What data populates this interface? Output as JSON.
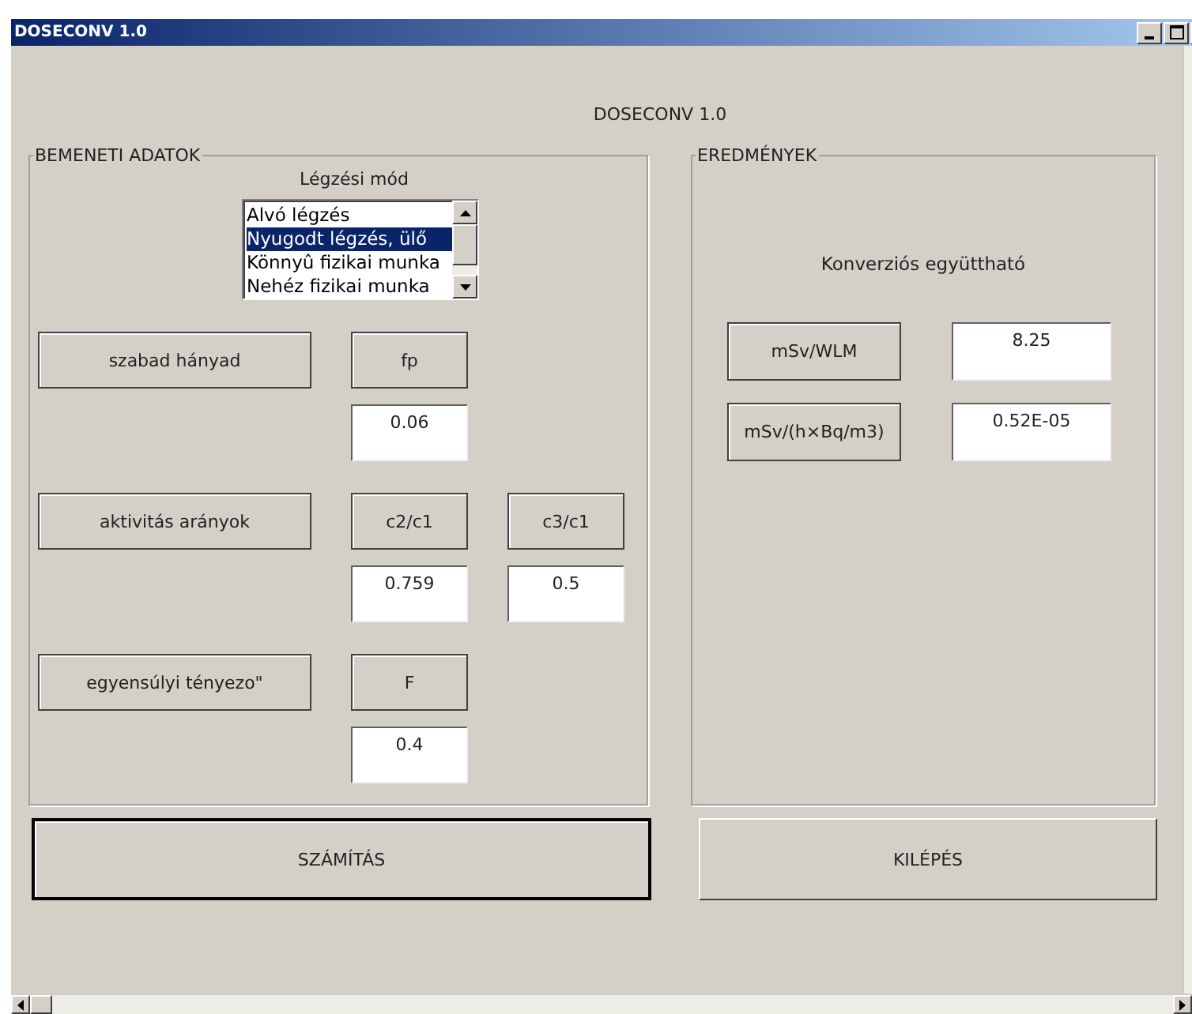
{
  "window": {
    "title": "DOSECONV 1.0"
  },
  "heading": "DOSECONV 1.0",
  "input_group": {
    "title": "BEMENETI ADATOK",
    "list_label": "Légzési mód",
    "list_items": [
      {
        "label": "Alvó légzés",
        "selected": false
      },
      {
        "label": "Nyugodt légzés, ülő",
        "selected": true
      },
      {
        "label": "Könnyû fizikai munka",
        "selected": false
      },
      {
        "label": "Nehéz fizikai munka",
        "selected": false
      }
    ],
    "rows": [
      {
        "label": "szabad hányad",
        "params": [
          {
            "symbol": "fp",
            "value": "0.06"
          }
        ]
      },
      {
        "label": "aktivitás arányok",
        "params": [
          {
            "symbol": "c2/c1",
            "value": "0.759"
          },
          {
            "symbol": "c3/c1",
            "value": "0.5"
          }
        ]
      },
      {
        "label": "egyensúlyi tényezo\"",
        "params": [
          {
            "symbol": "F",
            "value": "0.4"
          }
        ]
      }
    ]
  },
  "results_group": {
    "title": "EREDMÉNYEK",
    "subtitle": "Konverziós együttható",
    "rows": [
      {
        "unit": "mSv/WLM",
        "value": "8.25"
      },
      {
        "unit": "mSv/(h×Bq/m3)",
        "value": "0.52E-05"
      }
    ]
  },
  "buttons": [
    {
      "label": "SZÁMÍTÁS",
      "default": true
    },
    {
      "label": "KILÉPÉS",
      "default": false
    }
  ]
}
